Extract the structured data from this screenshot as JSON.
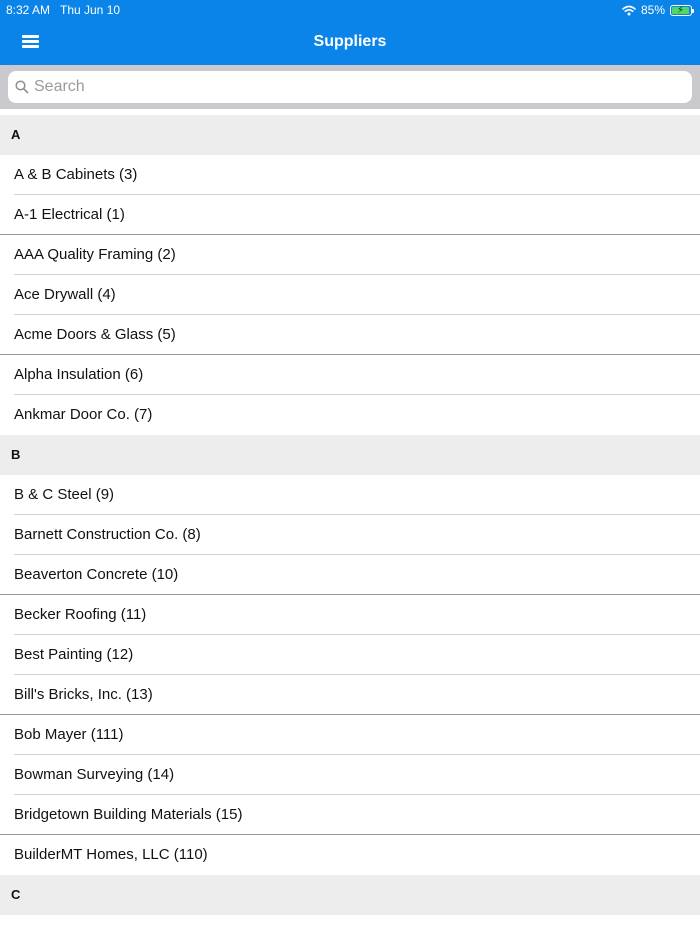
{
  "status_bar": {
    "time": "8:32 AM",
    "date": "Thu Jun 10",
    "battery_percent": "85%",
    "battery_level": 0.85
  },
  "nav": {
    "title": "Suppliers",
    "menu_icon": "hamburger-menu-icon",
    "bar_color": "#0a84e8"
  },
  "search": {
    "placeholder": "Search",
    "value": ""
  },
  "sections": [
    {
      "letter": "A",
      "items": [
        "A & B Cabinets (3)",
        "A-1 Electrical (1)",
        "AAA Quality Framing (2)",
        "Ace Drywall (4)",
        "Acme Doors & Glass (5)",
        "Alpha Insulation (6)",
        "Ankmar Door Co. (7)"
      ]
    },
    {
      "letter": "B",
      "items": [
        "B & C Steel (9)",
        "Barnett Construction Co. (8)",
        "Beaverton Concrete (10)",
        "Becker Roofing (11)",
        "Best Painting (12)",
        "Bill's Bricks, Inc. (13)",
        "Bob Mayer (111)",
        "Bowman Surveying (14)",
        "Bridgetown Building Materials (15)",
        "BuilderMT Homes, LLC (110)"
      ]
    },
    {
      "letter": "C",
      "items": []
    }
  ]
}
